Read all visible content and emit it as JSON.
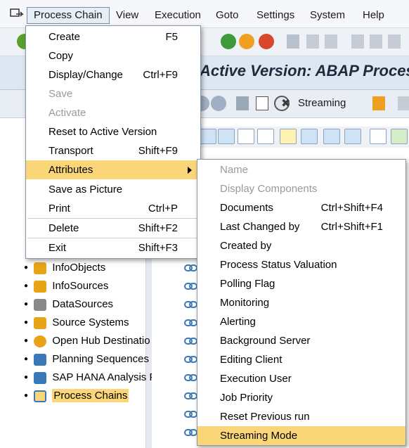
{
  "menubar": {
    "items": [
      "Process Chain",
      "View",
      "Execution",
      "Goto",
      "Settings",
      "System",
      "Help"
    ]
  },
  "title": {
    "text": "Active Version: ABAP Proces"
  },
  "app_toolbar": {
    "streaming_label": "Streaming"
  },
  "process_chain_menu": {
    "items": [
      {
        "label": "Create",
        "shortcut": "F5",
        "state": "enabled"
      },
      {
        "label": "Copy",
        "shortcut": "",
        "state": "enabled"
      },
      {
        "label": "Display/Change",
        "shortcut": "Ctrl+F9",
        "state": "enabled"
      },
      {
        "label": "Save",
        "shortcut": "",
        "state": "disabled"
      },
      {
        "label": "Activate",
        "shortcut": "",
        "state": "disabled"
      },
      {
        "label": "Reset to Active Version",
        "shortcut": "",
        "state": "enabled"
      },
      {
        "label": "Transport",
        "shortcut": "Shift+F9",
        "state": "enabled"
      },
      {
        "label": "Attributes",
        "shortcut": "",
        "state": "highlighted"
      },
      {
        "label": "Save as Picture",
        "shortcut": "",
        "state": "enabled"
      },
      {
        "label": "Print",
        "shortcut": "Ctrl+P",
        "state": "enabled"
      },
      {
        "label": "Delete",
        "shortcut": "Shift+F2",
        "state": "enabled"
      },
      {
        "label": "Exit",
        "shortcut": "Shift+F3",
        "state": "enabled"
      }
    ]
  },
  "attributes_menu": {
    "items": [
      {
        "label": "Name",
        "shortcut": "",
        "state": "disabled"
      },
      {
        "label": "Display Components",
        "shortcut": "",
        "state": "disabled"
      },
      {
        "label": "Documents",
        "shortcut": "Ctrl+Shift+F4",
        "state": "enabled"
      },
      {
        "label": "Last Changed by",
        "shortcut": "Ctrl+Shift+F1",
        "state": "enabled"
      },
      {
        "label": "Created by",
        "shortcut": "",
        "state": "enabled"
      },
      {
        "label": "Process Status Valuation",
        "shortcut": "",
        "state": "enabled"
      },
      {
        "label": "Polling Flag",
        "shortcut": "",
        "state": "enabled"
      },
      {
        "label": "Monitoring",
        "shortcut": "",
        "state": "enabled"
      },
      {
        "label": "Alerting",
        "shortcut": "",
        "state": "enabled"
      },
      {
        "label": "Background Server",
        "shortcut": "",
        "state": "enabled"
      },
      {
        "label": "Editing Client",
        "shortcut": "",
        "state": "enabled"
      },
      {
        "label": "Execution User",
        "shortcut": "",
        "state": "enabled"
      },
      {
        "label": "Job Priority",
        "shortcut": "",
        "state": "enabled"
      },
      {
        "label": "Reset Previous run",
        "shortcut": "",
        "state": "enabled"
      },
      {
        "label": "Streaming Mode",
        "shortcut": "",
        "state": "highlighted"
      }
    ]
  },
  "tree": {
    "items": [
      {
        "label": "InfoObjects",
        "icon": "infoobject-icon",
        "color": "#e8a317"
      },
      {
        "label": "InfoSources",
        "icon": "infosource-icon",
        "color": "#e8a317"
      },
      {
        "label": "DataSources",
        "icon": "datasource-icon",
        "color": "#8a8a8a"
      },
      {
        "label": "Source Systems",
        "icon": "source-system-icon",
        "color": "#e8a317"
      },
      {
        "label": "Open Hub Destinatio",
        "icon": "open-hub-icon",
        "color": "#e8a317"
      },
      {
        "label": "Planning Sequences",
        "icon": "planning-icon",
        "color": "#3a78b8"
      },
      {
        "label": "SAP HANA Analysis P",
        "icon": "hana-icon",
        "color": "#3a78b8"
      },
      {
        "label": "Process Chains",
        "icon": "process-chain-icon",
        "color": "#3a78b8"
      }
    ]
  },
  "colors": {
    "highlight": "#fbd679",
    "chain_icon": "#3a78b8"
  }
}
